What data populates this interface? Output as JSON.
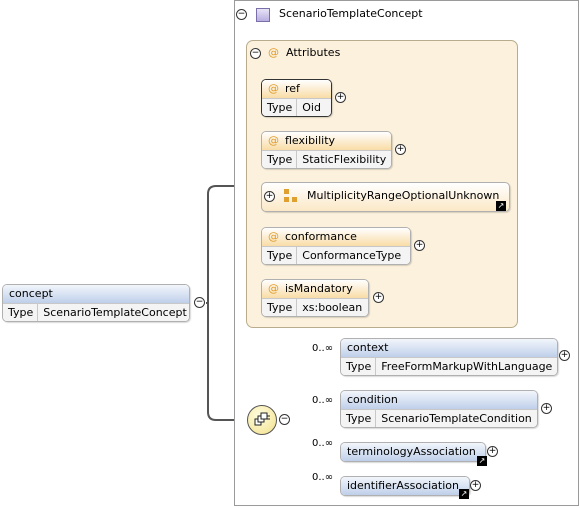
{
  "root": {
    "name": "concept",
    "type_key": "Type",
    "type_value": "ScenarioTemplateConcept"
  },
  "complex_type": {
    "name": "ScenarioTemplateConcept"
  },
  "attributes_group": {
    "label": "Attributes"
  },
  "attributes": [
    {
      "name": "ref",
      "type_key": "Type",
      "type_value": "Oid"
    },
    {
      "name": "flexibility",
      "type_key": "Type",
      "type_value": "StaticFlexibility"
    },
    {
      "name": "conformance",
      "type_key": "Type",
      "type_value": "ConformanceType"
    },
    {
      "name": "isMandatory",
      "type_key": "Type",
      "type_value": "xs:boolean"
    }
  ],
  "attribute_group_ref": {
    "name": "MultiplicityRangeOptionalUnknown"
  },
  "sequence_children": [
    {
      "occurrence": "0..∞",
      "name": "context",
      "type_key": "Type",
      "type_value": "FreeFormMarkupWithLanguage"
    },
    {
      "occurrence": "0..∞",
      "name": "condition",
      "type_key": "Type",
      "type_value": "ScenarioTemplateCondition"
    },
    {
      "occurrence": "0..∞",
      "name": "terminologyAssociation"
    },
    {
      "occurrence": "0..∞",
      "name": "identifierAssociation"
    }
  ],
  "symbols": {
    "at": "@",
    "collapse": "−",
    "expand": "+",
    "ref_arrow": "↗"
  },
  "colors": {
    "attribute_header": "#f8dca6",
    "element_header": "#bfcfea",
    "attributes_panel": "#fcf1dc",
    "at_symbol": "#e09b2b"
  }
}
